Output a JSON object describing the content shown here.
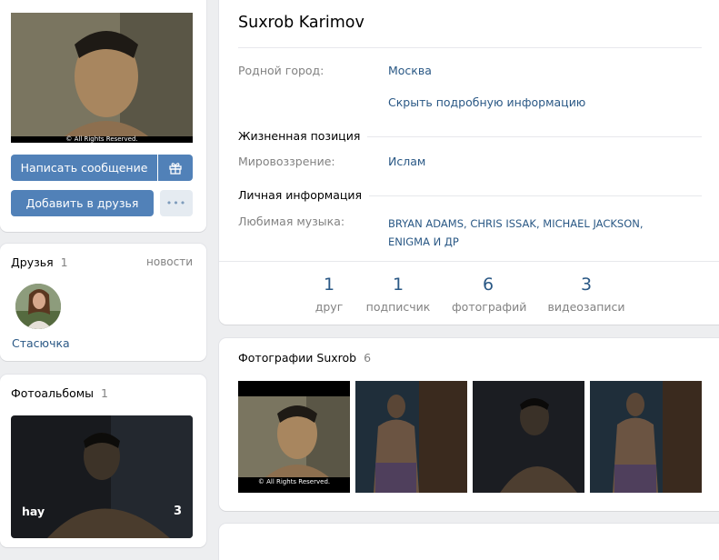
{
  "profile": {
    "name": "Suxrob Karimov",
    "avatar_watermark": "© All Rights Reserved.",
    "write_message_label": "Написать сообщение",
    "add_friend_label": "Добавить в друзья",
    "more_label": "•••"
  },
  "info": {
    "hometown_label": "Родной город:",
    "hometown_value": "Москва",
    "toggle_details": "Скрыть подробную информацию",
    "life_position_heading": "Жизненная позиция",
    "worldview_label": "Мировоззрение:",
    "worldview_value": "Ислам",
    "personal_heading": "Личная информация",
    "music_label": "Любимая музыка:",
    "music_line1_artists": [
      "BRYAN ADAMS",
      "CHRIS ISSAK",
      "MICHAEL JACKSON"
    ],
    "music_line1_sep": ", ",
    "music_line2": "ENIGMA И ДР"
  },
  "counters": [
    {
      "num": "1",
      "label": "друг"
    },
    {
      "num": "1",
      "label": "подписчик"
    },
    {
      "num": "6",
      "label": "фотографий"
    },
    {
      "num": "3",
      "label": "видеозаписи"
    }
  ],
  "friends": {
    "title": "Друзья",
    "count": "1",
    "news_link": "новости",
    "items": [
      {
        "name": "Стасючка"
      }
    ]
  },
  "albums": {
    "title": "Фотоальбомы",
    "count": "1",
    "album_name": "hay",
    "album_count": "3"
  },
  "photos": {
    "title": "Фотографии Suxrob",
    "count": "6",
    "watermark": "© All Rights Reserved."
  },
  "colors": {
    "accent": "#5181b8",
    "link": "#2a5885",
    "background": "#edeef0"
  },
  "icons": {
    "gift": "gift-icon",
    "more": "more-dots-icon"
  }
}
